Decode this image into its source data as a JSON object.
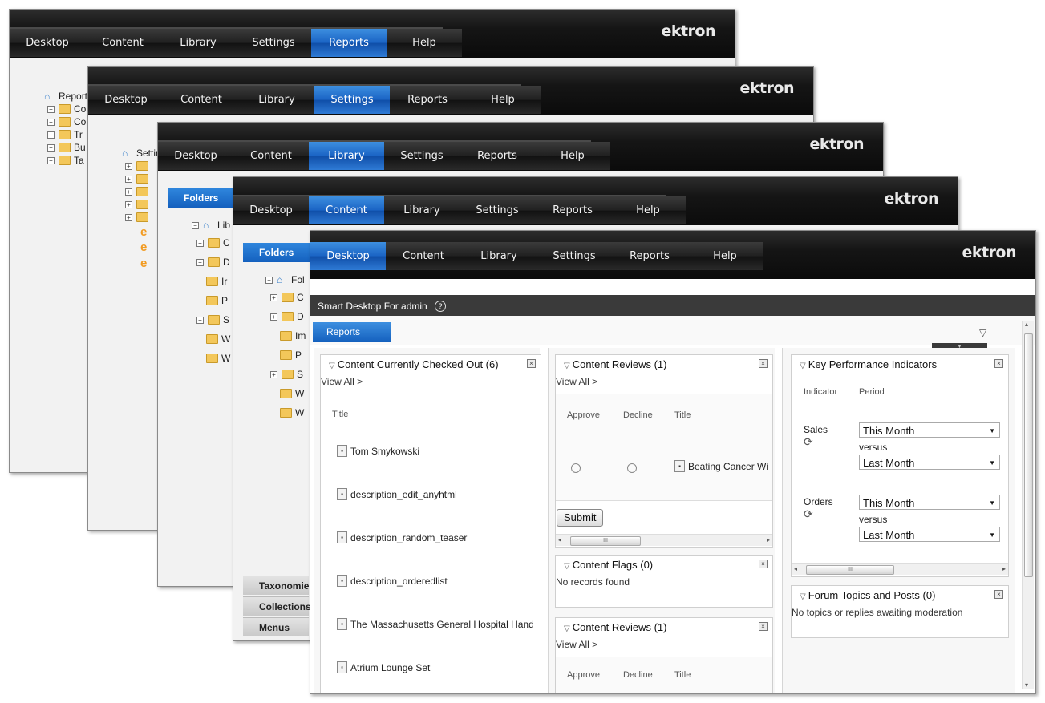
{
  "brand": "ektron",
  "windows": [
    {
      "nav": [
        "Desktop",
        "Content",
        "Library",
        "Settings",
        "Reports",
        "Help"
      ],
      "active": 4,
      "tree": {
        "root": "Reports",
        "children": [
          "Co",
          "Co",
          "Tr",
          "Bu",
          "Ta"
        ]
      }
    },
    {
      "nav": [
        "Desktop",
        "Content",
        "Library",
        "Settings",
        "Reports",
        "Help"
      ],
      "active": 3,
      "tree": {
        "root": "Settings",
        "children": [
          "",
          "",
          "",
          "",
          ""
        ]
      }
    },
    {
      "nav": [
        "Desktop",
        "Content",
        "Library",
        "Settings",
        "Reports",
        "Help"
      ],
      "active": 2,
      "folders_tab": "Folders",
      "tree": {
        "root": "Lib",
        "children": [
          "C",
          "D",
          "Ir",
          "P",
          "S",
          "W",
          "W"
        ]
      },
      "orange_marks": [
        "e",
        "e",
        "e"
      ]
    },
    {
      "nav": [
        "Desktop",
        "Content",
        "Library",
        "Settings",
        "Reports",
        "Help"
      ],
      "active": 1,
      "folders_tab": "Folders",
      "tree": {
        "root": "Fol",
        "children": [
          "C",
          "D",
          "Im",
          "P",
          "S",
          "W",
          "W"
        ]
      },
      "side_tabs": [
        "Taxonomie",
        "Collections",
        "Menus"
      ]
    }
  ],
  "front": {
    "nav": [
      "Desktop",
      "Content",
      "Library",
      "Settings",
      "Reports",
      "Help"
    ],
    "active": 0,
    "smart_desktop_title": "Smart Desktop For admin",
    "help_icon": "?",
    "reports_tab": "Reports",
    "checked_out": {
      "title": "Content Currently Checked Out (6)",
      "view_all": "View All >",
      "col_title": "Title",
      "items": [
        "Tom Smykowski",
        "description_edit_anyhtml",
        "description_random_teaser",
        "description_orderedlist",
        "The Massachusetts General Hospital Hand",
        "Atrium Lounge Set"
      ]
    },
    "reviews1": {
      "title": "Content Reviews (1)",
      "view_all": "View All >",
      "cols": [
        "Approve",
        "Decline",
        "Title"
      ],
      "row_title": "Beating Cancer Wi",
      "submit": "Submit",
      "scroll_thumb": "III"
    },
    "flags": {
      "title": "Content Flags (0)",
      "message": "No records found"
    },
    "reviews2": {
      "title": "Content Reviews (1)",
      "view_all": "View All >",
      "cols": [
        "Approve",
        "Decline",
        "Title"
      ]
    },
    "kpi": {
      "title": "Key Performance Indicators",
      "col_indicator": "Indicator",
      "col_period": "Period",
      "rows": [
        {
          "label": "Sales",
          "period": "This Month",
          "versus": "versus",
          "compare": "Last Month"
        },
        {
          "label": "Orders",
          "period": "This Month",
          "versus": "versus",
          "compare": "Last Month"
        }
      ],
      "scroll_thumb": "III"
    },
    "forum": {
      "title": "Forum Topics and Posts (0)",
      "message": "No topics or replies awaiting moderation"
    }
  }
}
